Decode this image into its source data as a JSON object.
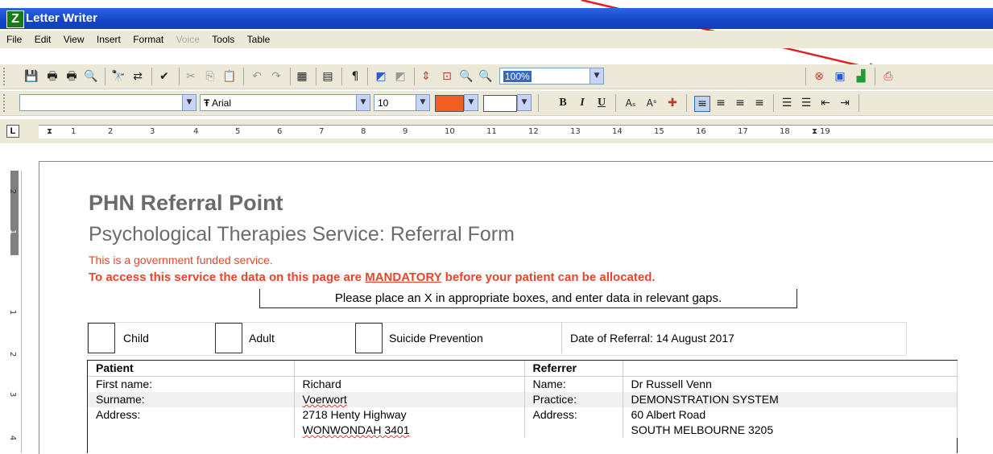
{
  "window": {
    "title": "Letter Writer",
    "logo": "Z"
  },
  "menu": [
    "File",
    "Edit",
    "View",
    "Insert",
    "Format",
    "Voice",
    "Tools",
    "Table"
  ],
  "menu_disabled": [
    "Voice"
  ],
  "toolbar1": {
    "icons": [
      "save-icon",
      "print-icon",
      "print-preview-icon",
      "preview-icon",
      "find-icon",
      "replace-icon",
      "spellcheck-icon",
      "cut-icon",
      "copy-icon",
      "paste-icon",
      "undo-icon",
      "redo-icon",
      "table-icon",
      "field-icon",
      "pilcrow-icon",
      "highlight-icon",
      "shading-icon",
      "page-icon",
      "fit-icon",
      "zoom-in-icon",
      "zoom-out-icon",
      "close-doc-icon",
      "contact-card-icon",
      "export-icon",
      "pdf-icon"
    ],
    "zoom_value": "100%"
  },
  "toolbar2": {
    "style_value": "",
    "font_value": "Arial",
    "font_prefix": "Ŧ",
    "size_value": "10",
    "text_color": "#f25d22",
    "bold": "B",
    "italic": "I",
    "underline": "U",
    "subscript": "Aₛ",
    "superscript": "Aˢ"
  },
  "ruler": {
    "corner": "L",
    "numbers": [
      "1",
      "2",
      "3",
      "4",
      "5",
      "6",
      "7",
      "8",
      "9",
      "10",
      "11",
      "12",
      "13",
      "14",
      "15",
      "16",
      "17",
      "18",
      "19"
    ]
  },
  "vruler": {
    "numbers": [
      "2",
      "1",
      "1",
      "2",
      "3",
      "4"
    ]
  },
  "document": {
    "heading": "PHN Referral Point",
    "subheading": "Psychological Therapies Service: Referral Form",
    "notice1": "This is a government funded service.",
    "notice2_pre": "To access this service the data on this page are ",
    "notice2_mandatory": "MANDATORY",
    "notice2_post": " before your patient can be allocated.",
    "instruction": "Please place an X in appropriate boxes, and enter data in relevant gaps.",
    "checkboxes": [
      "Child",
      "Adult",
      "Suicide Prevention"
    ],
    "date_of_referral": "Date of Referral: 14 August 2017",
    "table": {
      "patient_header": "Patient",
      "referrer_header": "Referrer",
      "rows": [
        {
          "pl": "First name:",
          "pv": "Richard",
          "rl": "Name:",
          "rv": "Dr Russell Venn"
        },
        {
          "pl": "Surname:",
          "pv": "Voerwort",
          "rl": "Practice:",
          "rv": "DEMONSTRATION SYSTEM"
        },
        {
          "pl": "Address:",
          "pv": "2718 Henty Highway",
          "rl": "Address:",
          "rv": "60 Albert Road"
        },
        {
          "pl": "",
          "pv": "WONWONDAH  3401",
          "rl": "",
          "rv": "SOUTH MELBOURNE  3205"
        }
      ]
    }
  },
  "colors": {
    "title_bar": "#1a4fd0",
    "accent_red": "#e8442c",
    "annotation_arrow": "#e02020"
  }
}
